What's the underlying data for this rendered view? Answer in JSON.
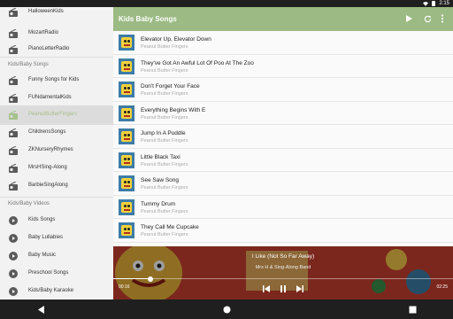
{
  "status_bar": {
    "time": "2:15"
  },
  "sidebar": {
    "top_items": [
      {
        "label": "HalloweenKids"
      },
      {
        "label": "MozartRadio"
      },
      {
        "label": "PianoLetterRadio"
      }
    ],
    "section1_title": "Kids/Baby Songs",
    "section1_items": [
      {
        "label": "Funny Songs for Kids"
      },
      {
        "label": "FUNdamentalKids"
      },
      {
        "label": "PeanutButterFingers"
      },
      {
        "label": "ChildrensSongs"
      },
      {
        "label": "ZKNurseryRhymes"
      },
      {
        "label": "MrsHSing-Along"
      },
      {
        "label": "BarbieSingAlong"
      }
    ],
    "section2_title": "Kids/Baby Videos",
    "section2_items": [
      {
        "label": "Kids Songs"
      },
      {
        "label": "Baby Lullabies"
      },
      {
        "label": "Baby Music"
      },
      {
        "label": "Preschool Songs"
      },
      {
        "label": "Kids/Baby Karaoke"
      }
    ]
  },
  "toolbar": {
    "title": "Kids Baby Songs"
  },
  "songs": [
    {
      "title": "Elevator Up, Elevator Down",
      "artist": "Peanut Butter Fingers"
    },
    {
      "title": "They've Got An Awful Lot Of Poo At The Zoo",
      "artist": "Peanut Butter Fingers"
    },
    {
      "title": "Don't Forget Your Face",
      "artist": "Peanut Butter Fingers"
    },
    {
      "title": "Everything Begins With E",
      "artist": "Peanut Butter Fingers"
    },
    {
      "title": "Jump In A Puddle",
      "artist": "Peanut Butter Fingers"
    },
    {
      "title": "Little Black Taxi",
      "artist": "Peanut Butter Fingers"
    },
    {
      "title": "See Saw Song",
      "artist": "Peanut Butter Fingers"
    },
    {
      "title": "Tummy Drum",
      "artist": "Peanut Butter Fingers"
    },
    {
      "title": "They Call Me Cupcake",
      "artist": "Peanut Butter Fingers"
    }
  ],
  "player": {
    "title": "I Like (Not So Far Away)",
    "artist": "Mrs H & Sing-Along Band",
    "current_time": "00:16",
    "total_time": "02:25",
    "progress": 0.11
  },
  "colors": {
    "accent": "#9cba83",
    "selected_text": "#a5c08a"
  }
}
